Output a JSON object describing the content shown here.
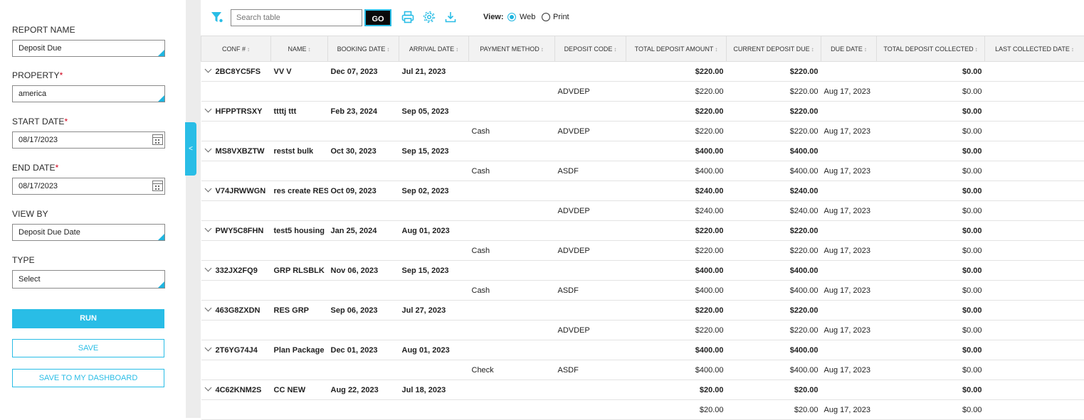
{
  "filters": {
    "report_name": {
      "label": "REPORT NAME",
      "value": "Deposit Due"
    },
    "property": {
      "label": "PROPERTY",
      "required_mark": "*",
      "value": "america"
    },
    "start_date": {
      "label": "START DATE",
      "required_mark": "*",
      "value": "08/17/2023"
    },
    "end_date": {
      "label": "END DATE",
      "required_mark": "*",
      "value": "08/17/2023"
    },
    "view_by": {
      "label": "VIEW BY",
      "value": "Deposit Due Date"
    },
    "type": {
      "label": "TYPE",
      "value": "Select"
    },
    "run_label": "RUN",
    "save_label": "SAVE",
    "save_dashboard_label": "SAVE TO MY DASHBOARD",
    "collapse_glyph": "<"
  },
  "toolbar": {
    "search_placeholder": "Search table",
    "go_label": "GO",
    "view_label": "View:",
    "view_options": [
      "Web",
      "Print"
    ],
    "selected_view": "Web",
    "icons": [
      "filter-icon",
      "print-icon",
      "settings-gear-icon",
      "download-icon"
    ]
  },
  "colors": {
    "accent": "#29bde6",
    "required": "#d0021b",
    "header_bg": "#f2f2f2"
  },
  "table": {
    "columns": [
      "CONF #",
      "NAME",
      "BOOKING DATE",
      "ARRIVAL DATE",
      "PAYMENT METHOD",
      "DEPOSIT CODE",
      "TOTAL DEPOSIT AMOUNT",
      "CURRENT DEPOSIT DUE",
      "DUE DATE",
      "TOTAL DEPOSIT COLLECTED",
      "LAST COLLECTED DATE"
    ],
    "rows": [
      {
        "kind": "parent",
        "cells": [
          "2BC8YC5FS",
          "VV V",
          "Dec 07, 2023",
          "Jul 21, 2023",
          "",
          "",
          "$220.00",
          "$220.00",
          "",
          "$0.00",
          ""
        ]
      },
      {
        "kind": "child",
        "cells": [
          "",
          "",
          "",
          "",
          "",
          "ADVDEP",
          "$220.00",
          "$220.00",
          "Aug 17, 2023",
          "$0.00",
          ""
        ]
      },
      {
        "kind": "parent",
        "cells": [
          "HFPPTRSXY",
          "ttttj ttt",
          "Feb 23, 2024",
          "Sep 05, 2023",
          "",
          "",
          "$220.00",
          "$220.00",
          "",
          "$0.00",
          ""
        ]
      },
      {
        "kind": "child",
        "cells": [
          "",
          "",
          "",
          "",
          "Cash",
          "ADVDEP",
          "$220.00",
          "$220.00",
          "Aug 17, 2023",
          "$0.00",
          ""
        ]
      },
      {
        "kind": "parent",
        "cells": [
          "MS8VXBZTW",
          "restst bulk",
          "Oct 30, 2023",
          "Sep 15, 2023",
          "",
          "",
          "$400.00",
          "$400.00",
          "",
          "$0.00",
          ""
        ]
      },
      {
        "kind": "child",
        "cells": [
          "",
          "",
          "",
          "",
          "Cash",
          "ASDF",
          "$400.00",
          "$400.00",
          "Aug 17, 2023",
          "$0.00",
          ""
        ]
      },
      {
        "kind": "parent",
        "cells": [
          "V74JRWWGN",
          "res create RES",
          "Oct 09, 2023",
          "Sep 02, 2023",
          "",
          "",
          "$240.00",
          "$240.00",
          "",
          "$0.00",
          ""
        ]
      },
      {
        "kind": "child",
        "cells": [
          "",
          "",
          "",
          "",
          "",
          "ADVDEP",
          "$240.00",
          "$240.00",
          "Aug 17, 2023",
          "$0.00",
          ""
        ]
      },
      {
        "kind": "parent",
        "cells": [
          "PWY5C8FHN",
          "test5 housing",
          "Jan 25, 2024",
          "Aug 01, 2023",
          "",
          "",
          "$220.00",
          "$220.00",
          "",
          "$0.00",
          ""
        ]
      },
      {
        "kind": "child",
        "cells": [
          "",
          "",
          "",
          "",
          "Cash",
          "ADVDEP",
          "$220.00",
          "$220.00",
          "Aug 17, 2023",
          "$0.00",
          ""
        ]
      },
      {
        "kind": "parent",
        "cells": [
          "332JX2FQ9",
          "GRP RLSBLK",
          "Nov 06, 2023",
          "Sep 15, 2023",
          "",
          "",
          "$400.00",
          "$400.00",
          "",
          "$0.00",
          ""
        ]
      },
      {
        "kind": "child",
        "cells": [
          "",
          "",
          "",
          "",
          "Cash",
          "ASDF",
          "$400.00",
          "$400.00",
          "Aug 17, 2023",
          "$0.00",
          ""
        ]
      },
      {
        "kind": "parent",
        "cells": [
          "463G8ZXDN",
          "RES GRP",
          "Sep 06, 2023",
          "Jul 27, 2023",
          "",
          "",
          "$220.00",
          "$220.00",
          "",
          "$0.00",
          ""
        ]
      },
      {
        "kind": "child",
        "cells": [
          "",
          "",
          "",
          "",
          "",
          "ADVDEP",
          "$220.00",
          "$220.00",
          "Aug 17, 2023",
          "$0.00",
          ""
        ]
      },
      {
        "kind": "parent",
        "cells": [
          "2T6YG74J4",
          "Plan Package",
          "Dec 01, 2023",
          "Aug 01, 2023",
          "",
          "",
          "$400.00",
          "$400.00",
          "",
          "$0.00",
          ""
        ]
      },
      {
        "kind": "child",
        "cells": [
          "",
          "",
          "",
          "",
          "Check",
          "ASDF",
          "$400.00",
          "$400.00",
          "Aug 17, 2023",
          "$0.00",
          ""
        ]
      },
      {
        "kind": "parent",
        "cells": [
          "4C62KNM2S",
          "CC NEW",
          "Aug 22, 2023",
          "Jul 18, 2023",
          "",
          "",
          "$20.00",
          "$20.00",
          "",
          "$0.00",
          ""
        ]
      },
      {
        "kind": "child",
        "cells": [
          "",
          "",
          "",
          "",
          "",
          "",
          "$20.00",
          "$20.00",
          "Aug 17, 2023",
          "$0.00",
          ""
        ]
      }
    ]
  }
}
